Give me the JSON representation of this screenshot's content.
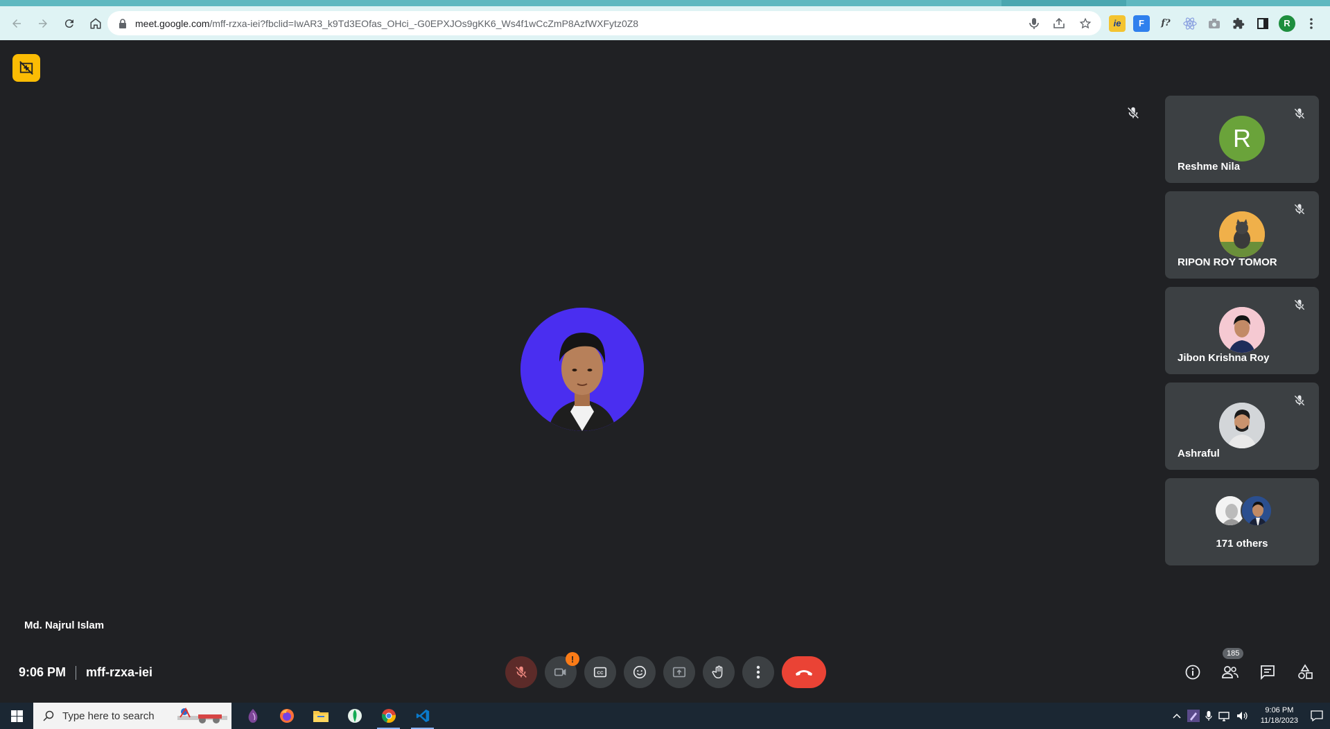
{
  "browser": {
    "url_host": "meet.google.com",
    "url_path": "/mff-rzxa-iei?fbclid=IwAR3_k9Td3EOfas_OHci_-G0EPXJOs9gKK6_Ws4f1wCcZmP8AzfWXFytz0Z8",
    "profile_initial": "R"
  },
  "meeting": {
    "main_speaker_name": "Md. Najrul Islam",
    "time": "9:06 PM",
    "code": "mff-rzxa-iei",
    "participant_count": "185"
  },
  "participants": [
    {
      "name": "Reshme Nila",
      "initial": "R",
      "color": "#6aa33a"
    },
    {
      "name": "RIPON ROY TOMOR"
    },
    {
      "name": "Jibon Krishna Roy"
    },
    {
      "name": "Ashraful"
    }
  ],
  "others": {
    "label": "171 others"
  },
  "taskbar": {
    "search_placeholder": "Type here to search",
    "time": "9:06 PM",
    "date": "11/18/2023"
  },
  "colors": {
    "end_call": "#ea4335",
    "mic_off": "#5c2b29",
    "meet_bg": "#202124",
    "tile_bg": "#3c4043"
  }
}
